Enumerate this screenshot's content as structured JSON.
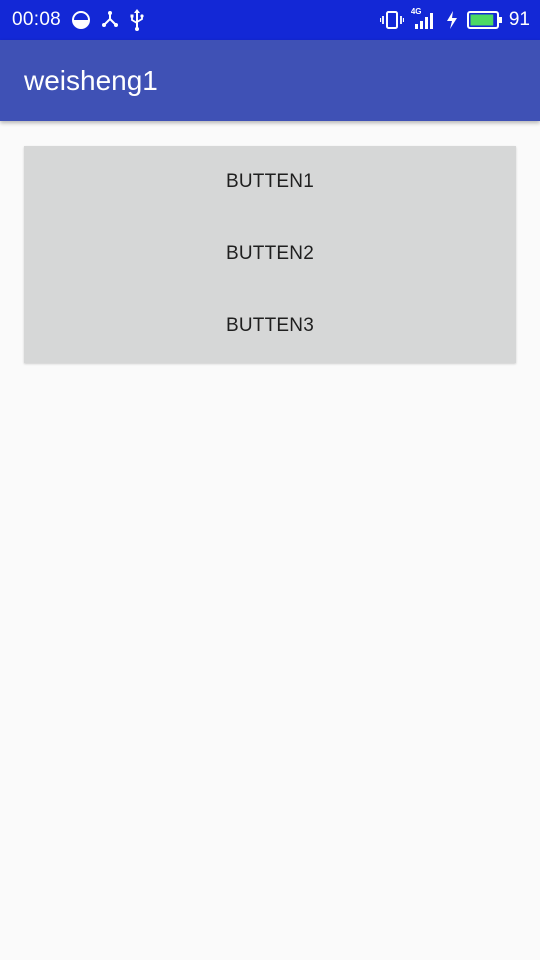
{
  "status_bar": {
    "time": "00:08",
    "network_label": "4G",
    "battery_level": "91",
    "left_icons": [
      "data-saver-icon",
      "share-icon",
      "usb-icon"
    ],
    "right_icons": [
      "vibrate-icon",
      "signal-icon",
      "charging-icon",
      "battery-icon"
    ],
    "colors": {
      "background": "#1328d6",
      "battery_fill": "#4cd964"
    }
  },
  "app_bar": {
    "title": "weisheng1",
    "color": "#3f51b5"
  },
  "buttons": [
    {
      "label": "BUTTEN1"
    },
    {
      "label": "BUTTEN2"
    },
    {
      "label": "BUTTEN3"
    }
  ],
  "colors": {
    "page_background": "#fafafa",
    "button_background": "#d6d7d7"
  }
}
